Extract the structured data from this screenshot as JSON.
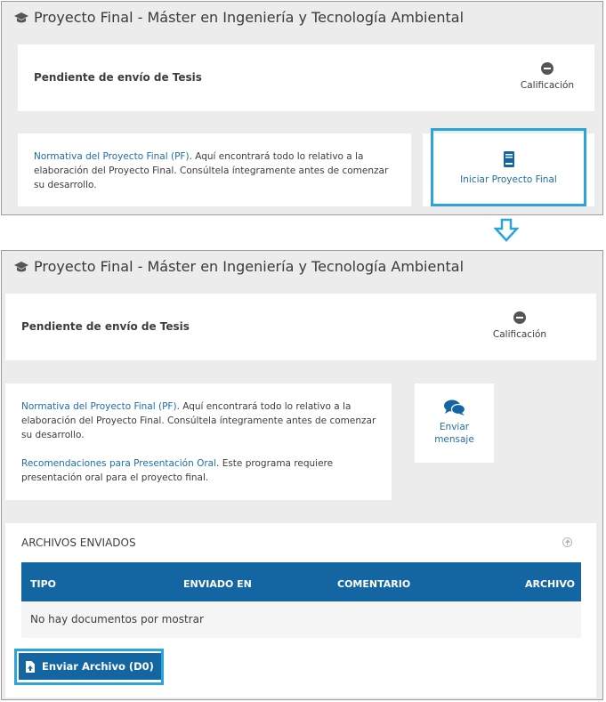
{
  "top_panel": {
    "title": "Proyecto Final - Máster en Ingeniería y Tecnología Ambiental",
    "status": "Pendiente de envío de Tesis",
    "grade_label": "Calificación",
    "normativa_link": "Normativa del Proyecto Final (PF)",
    "normativa_text": ". Aquí encontrará todo lo relativo a la elaboración del Proyecto Final. Consúltela íntegramente antes de comenzar su desarrollo.",
    "action_label": "Iniciar Proyecto Final"
  },
  "bottom_panel": {
    "title": "Proyecto Final - Máster en Ingeniería y Tecnología Ambiental",
    "status": "Pendiente de envío de Tesis",
    "grade_label": "Calificación",
    "normativa_link": "Normativa del Proyecto Final (PF)",
    "normativa_text": ". Aquí encontrará todo lo relativo a la elaboración del Proyecto Final. Consúltela íntegramente antes de comenzar su desarrollo.",
    "recomendaciones_link": "Recomendaciones para Presentación Oral",
    "recomendaciones_text": ". Este programa requiere presentación oral para el proyecto final.",
    "message_label_1": "Enviar",
    "message_label_2": "mensaje",
    "files_header": "ARCHIVOS ENVIADOS",
    "table_headers": [
      "TIPO",
      "ENVIADO EN",
      "COMENTARIO",
      "ARCHIVO"
    ],
    "empty_message": "No hay documentos por mostrar",
    "upload_button": "Enviar Archivo (D0)"
  },
  "colors": {
    "panel_bg": "#ececec",
    "accent": "#1466a3",
    "highlight": "#2aa4dc",
    "link": "#1f6ea8"
  }
}
